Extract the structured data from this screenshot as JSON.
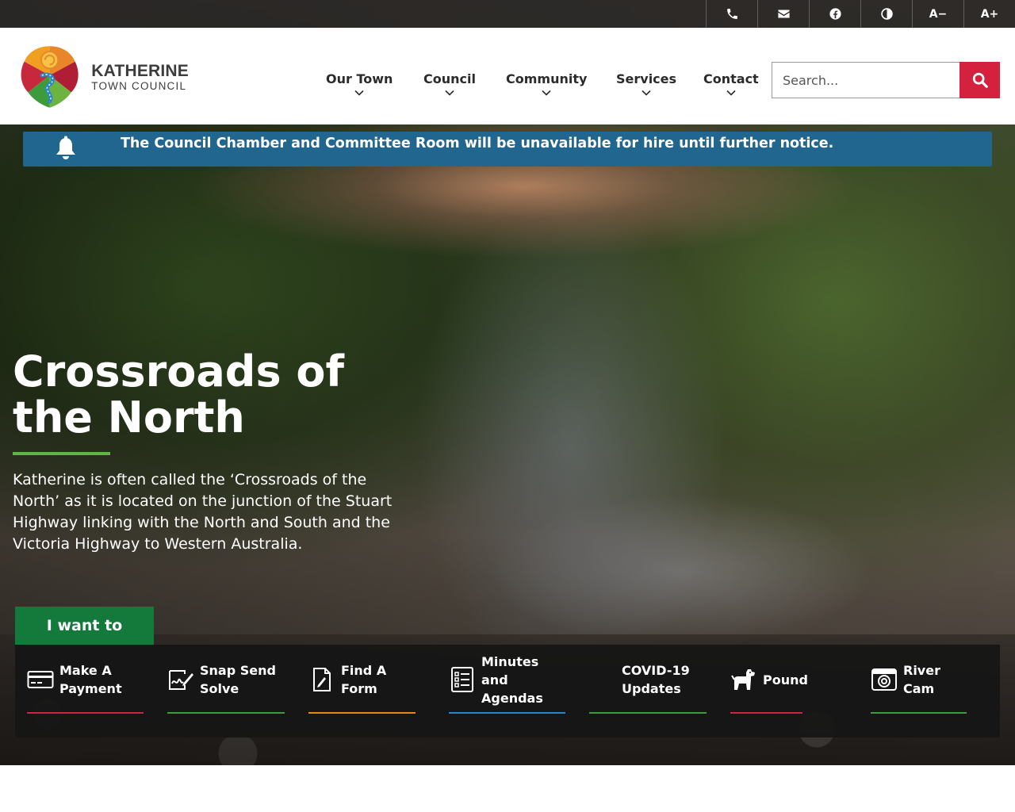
{
  "topbar": {
    "buttons": [
      {
        "icon": "phone-icon"
      },
      {
        "icon": "email-icon"
      },
      {
        "icon": "facebook-icon"
      },
      {
        "icon": "contrast-icon"
      },
      {
        "label": "A−"
      },
      {
        "label": "A+"
      }
    ]
  },
  "header": {
    "logo": {
      "line1": "KATHERINE",
      "line2": "TOWN COUNCIL"
    },
    "nav": [
      {
        "label": "Our Town"
      },
      {
        "label": "Council"
      },
      {
        "label": "Community"
      },
      {
        "label": "Services"
      },
      {
        "label": "Contact"
      }
    ],
    "search": {
      "placeholder": "Search..."
    }
  },
  "notice": {
    "text": "The Council Chamber and Committee Room will be unavailable for hire until further notice."
  },
  "hero": {
    "title": "Crossroads of the North",
    "description": "Katherine is often called the ‘Crossroads of the North’ as it is located on the junction of the Stuart Highway linking with the North and South and the Victoria Highway to Western Australia."
  },
  "quick_links": {
    "tab_label": "I want to",
    "items": [
      {
        "label": "Make A Payment",
        "icon": "credit-card-icon",
        "accent": "#c8283c"
      },
      {
        "label": "Snap Send Solve",
        "icon": "signature-icon",
        "accent": "#3f9a3c"
      },
      {
        "label": "Find A Form",
        "icon": "document-edit-icon",
        "accent": "#e08a1e"
      },
      {
        "label": "Minutes and Agendas",
        "icon": "checklist-icon",
        "accent": "#2a86c7"
      },
      {
        "label": "COVID-19 Updates",
        "icon": "",
        "accent": "#3f9a3c"
      },
      {
        "label": "Pound",
        "icon": "dog-icon",
        "accent": "#c8283c"
      },
      {
        "label": "River Cam",
        "icon": "camera-icon",
        "accent": "#3f9a3c"
      }
    ]
  },
  "colors": {
    "brand_red": "#d4213d",
    "notice_blue": "#20668f",
    "brand_green": "#137a3b",
    "accent_green": "#5fb546"
  }
}
